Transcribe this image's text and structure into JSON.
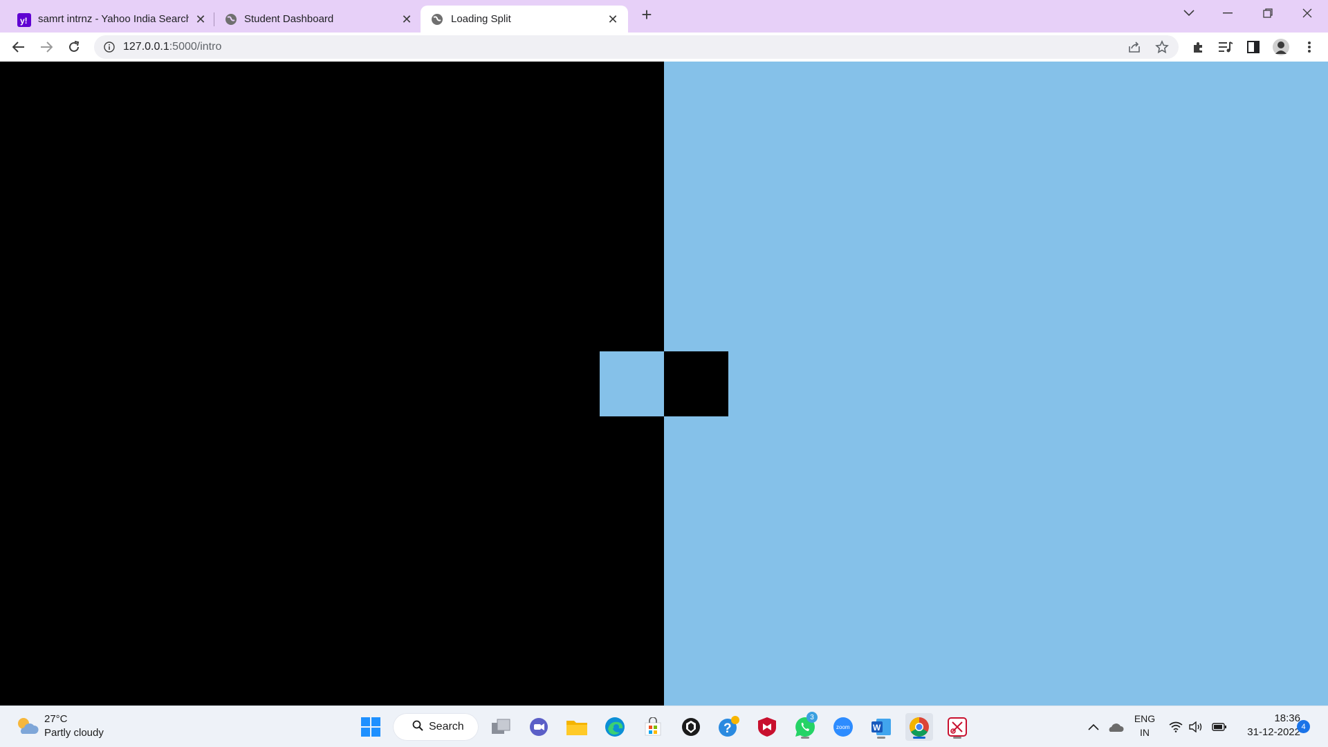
{
  "browser": {
    "tabs": [
      {
        "title": "samrt intrnz - Yahoo India Search",
        "favicon": "yahoo-icon",
        "active": false
      },
      {
        "title": "Student Dashboard",
        "favicon": "globe-icon",
        "active": false
      },
      {
        "title": "Loading Split",
        "favicon": "globe-icon",
        "active": true
      }
    ],
    "address": {
      "host": "127.0.0.1",
      "path": ":5000/intro"
    },
    "accent_color": "#e7d0f8"
  },
  "page": {
    "left_color": "#000000",
    "right_color": "#85c1e9"
  },
  "taskbar": {
    "weather": {
      "temp": "27°C",
      "desc": "Partly cloudy"
    },
    "search_label": "Search",
    "whatsapp_badge": "3",
    "language": {
      "line1": "ENG",
      "line2": "IN"
    },
    "clock": {
      "time": "18:36",
      "date": "31-12-2022"
    },
    "notification_count": "4"
  }
}
